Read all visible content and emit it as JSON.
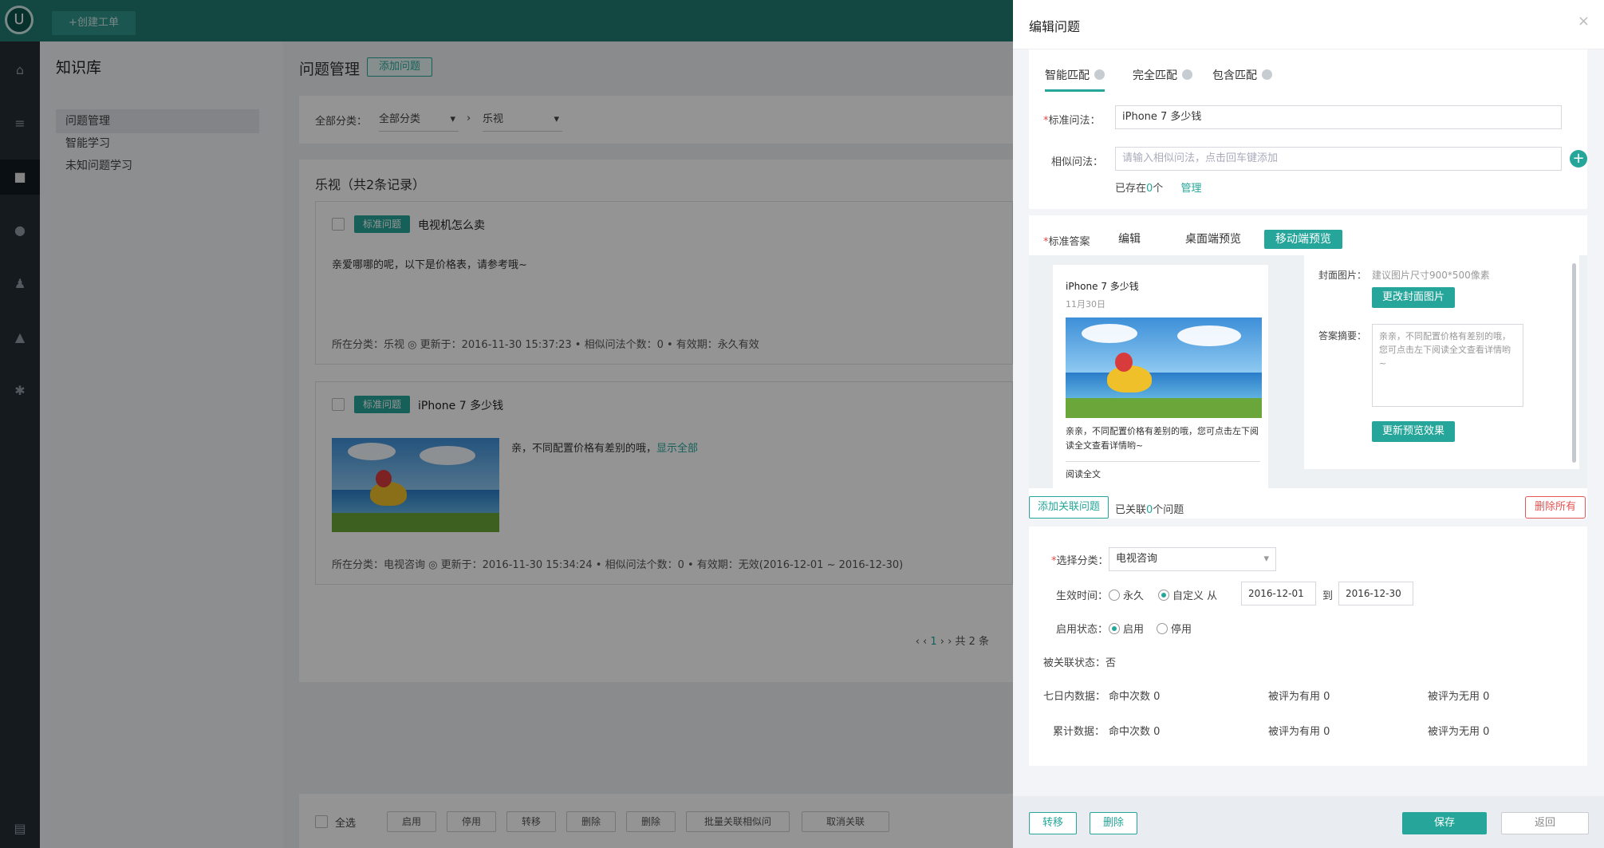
{
  "app": {
    "logo_glyph": "U",
    "top_button": "+创建工单",
    "brand_color": "#26a69a",
    "rail_icons": [
      "home-icon",
      "list-icon",
      "book-icon",
      "user-icon",
      "group-icon",
      "chart-icon",
      "settings-icon",
      "menu-icon"
    ]
  },
  "sidebar": {
    "title": "知识库",
    "items": [
      {
        "label": "问题管理"
      },
      {
        "label": "智能学习"
      },
      {
        "label": "未知问题学习"
      }
    ]
  },
  "main": {
    "title": "问题管理",
    "add_button": "添加问题",
    "filter": {
      "label": "全部分类：",
      "select1": "全部分类",
      "select1_arrow": "▾",
      "separator": "›",
      "select2": "乐视",
      "select2_arrow": "▾"
    },
    "list_title": "乐视（共2条记录）",
    "cards": [
      {
        "tag": "标准问题",
        "title": "电视机怎么卖",
        "body": "亲爱哪哪的呢，以下是价格表，请参考哦~",
        "meta": "所在分类：乐视  ◎ 更新于：2016-11-30 15:37:23  • 相似问法个数：0  • 有效期：永久有效"
      },
      {
        "tag": "标准问题",
        "title": "iPhone 7 多少钱",
        "body": "亲，不同配置价格有差别的哦，",
        "more": "显示全部",
        "meta": "所在分类：电视咨询  ◎ 更新于：2016-11-30 15:34:24  • 相似问法个数：0  • 有效期：无效(2016-12-01 ~ 2016-12-30)"
      }
    ],
    "pager": {
      "prev": "‹ ‹",
      "current": "1",
      "next": "› ›",
      "total": "共 2 条"
    },
    "bottom": {
      "select_all": "全选",
      "buttons": [
        "启用",
        "停用",
        "转移",
        "删除",
        "删除",
        "批量关联相似问",
        "取消关联"
      ]
    }
  },
  "drawer": {
    "title": "编辑问题",
    "close": "×",
    "tabs": [
      "智能匹配",
      "完全匹配",
      "包含匹配"
    ],
    "std_label": "标准问法：",
    "std_value": "iPhone 7 多少钱",
    "sim_label": "相似问法：",
    "sim_placeholder": "请输入相似问法，点击回车键添加",
    "exists_prefix": "已存在",
    "exists_count": "0",
    "exists_suffix": "个",
    "manage": "管理",
    "answer_label": "标准答案",
    "answer_tabs": [
      "编辑",
      "桌面端预览",
      "移动端预览"
    ],
    "preview": {
      "title": "iPhone 7 多少钱",
      "date": "11月30日",
      "text": "亲亲，不同配置价格有差别的哦，您可点击左下阅读全文查看详情哟~",
      "read_more": "阅读全文"
    },
    "cover_label": "封面图片：",
    "cover_hint": "建议图片尺寸900*500像素",
    "cover_btn": "更改封面图片",
    "summary_label": "答案摘要：",
    "summary_text": "亲亲，不同配置价格有差别的哦，您可点击左下阅读全文查看详情哟~",
    "update_preview_btn": "更新预览效果",
    "add_related_btn": "添加关联问题",
    "related_prefix": "已关联",
    "related_count": "0",
    "related_suffix": "个问题",
    "delete_all_btn": "删除所有",
    "category_label": "选择分类：",
    "category_value": "电视咨询",
    "category_arrow": "▾",
    "time_label": "生效时间：",
    "time_forever": "永久",
    "time_custom": "自定义 从",
    "time_from": "2016-12-01",
    "time_to_label": "到",
    "time_to": "2016-12-30",
    "status_label": "启用状态：",
    "status_on": "启用",
    "status_off": "停用",
    "linked_label": "被关联状态：否",
    "week_label": "七日内数据：",
    "total_label": "累计数据：",
    "stats_week": [
      "命中次数 0",
      "被评为有用 0",
      "被评为无用 0"
    ],
    "stats_total": [
      "命中次数 0",
      "被评为有用 0",
      "被评为无用 0"
    ],
    "footer": {
      "move": "转移",
      "delete": "删除",
      "save": "保存",
      "back": "返回"
    }
  }
}
